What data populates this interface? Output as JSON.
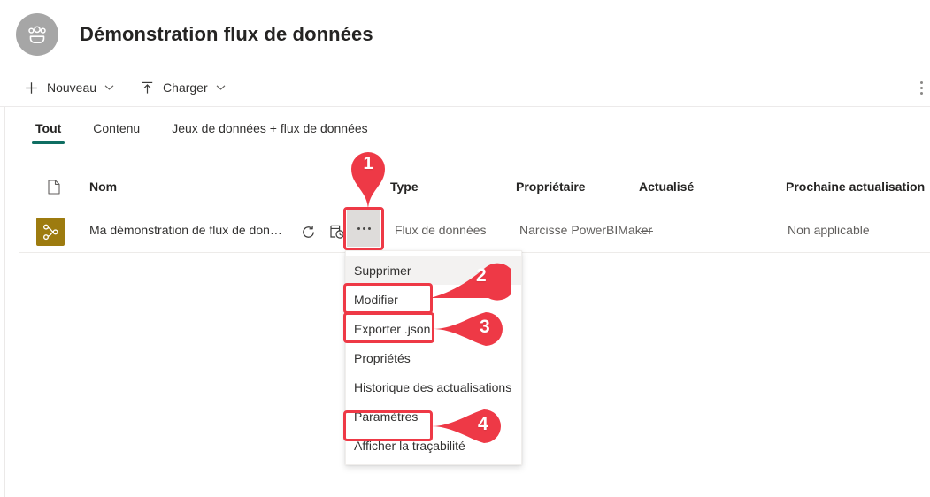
{
  "header": {
    "workspace_icon": "people-group-icon",
    "title": "Démonstration flux de données"
  },
  "toolbar": {
    "new_label": "Nouveau",
    "new_icon": "plus-icon",
    "upload_label": "Charger",
    "upload_icon": "upload-arrow-icon",
    "chevron_icon": "chevron-down-icon",
    "overflow_icon": "more-vertical-icon"
  },
  "tabs": [
    {
      "label": "Tout",
      "active": true
    },
    {
      "label": "Contenu",
      "active": false
    },
    {
      "label": "Jeux de données + flux de données",
      "active": false
    }
  ],
  "table": {
    "columns": {
      "type_icon": "file-icon",
      "name": "Nom",
      "type": "Type",
      "owner": "Propriétaire",
      "refreshed": "Actualisé",
      "next_refresh": "Prochaine actualisation"
    },
    "rows": [
      {
        "item_icon": "dataflow-icon",
        "icon_color": "#9d7b0f",
        "name": "Ma démonstration de flux de don…",
        "refresh_icon": "refresh-icon",
        "schedule_icon": "scheduled-refresh-icon",
        "more_icon": "more-horizontal-icon",
        "type": "Flux de données",
        "owner": "Narcisse PowerBIMaker",
        "refreshed": "—",
        "next_refresh": "Non applicable"
      }
    ]
  },
  "context_menu": {
    "items": [
      {
        "label": "Supprimer",
        "hovered": true
      },
      {
        "label": "Modifier",
        "hovered": false
      },
      {
        "label": "Exporter .json",
        "hovered": false
      },
      {
        "label": "Propriétés",
        "hovered": false
      },
      {
        "label": "Historique des actualisations",
        "hovered": false
      },
      {
        "label": "Paramètres",
        "hovered": false
      },
      {
        "label": "Afficher la traçabilité",
        "hovered": false
      }
    ]
  },
  "annotations": {
    "color": "#ee3946",
    "markers": [
      {
        "number": "1",
        "shape": "pin-down",
        "target": "row-more-button"
      },
      {
        "number": "2",
        "shape": "arrow-left",
        "target": "menu-item-modifier"
      },
      {
        "number": "3",
        "shape": "arrow-left",
        "target": "menu-item-exporter-json"
      },
      {
        "number": "4",
        "shape": "arrow-left",
        "target": "menu-item-parametres"
      }
    ]
  },
  "colors": {
    "accent_tab_underline": "#0f6e62",
    "annotation_red": "#ee3946",
    "dataflow_gold": "#9d7b0f",
    "avatar_gray": "#a6a6a6"
  }
}
